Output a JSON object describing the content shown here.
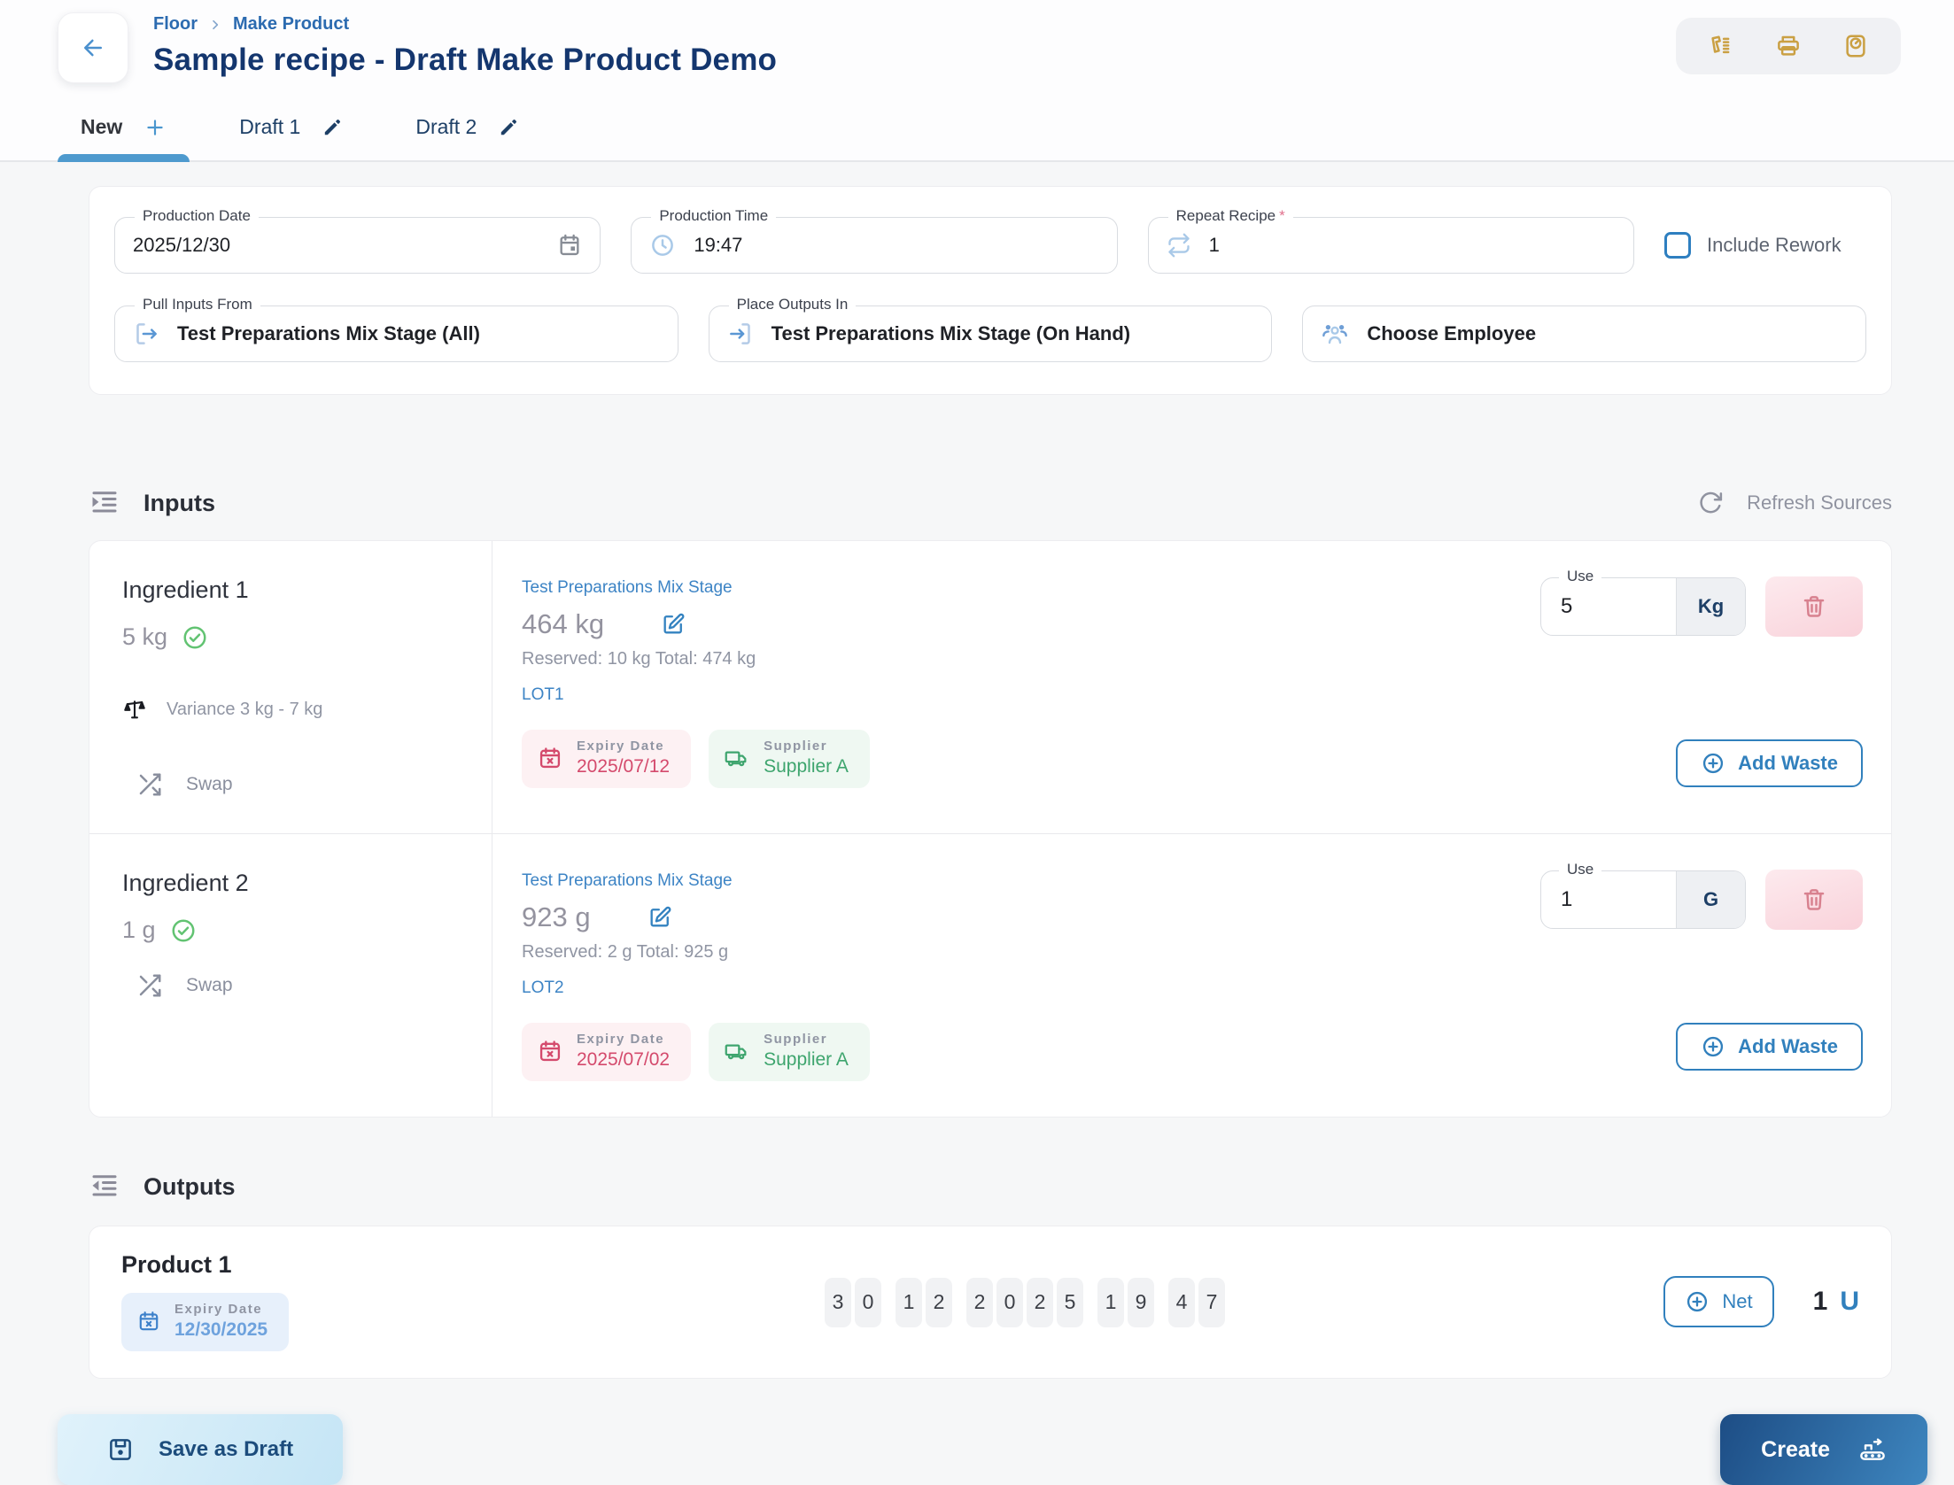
{
  "colors": {
    "accent_blue": "#3180bd",
    "navy_title": "#14366e",
    "amber_icons": "#caa043",
    "danger_red": "#d44a6c",
    "success_green": "#3ea56e",
    "tab_underline": "#4e9ace"
  },
  "header": {
    "breadcrumb": [
      "Floor",
      "Make Product"
    ],
    "title": "Sample recipe - Draft Make Product Demo"
  },
  "tabs": {
    "new_label": "New",
    "draft1_label": "Draft 1",
    "draft2_label": "Draft 2"
  },
  "form": {
    "production_date": {
      "label": "Production Date",
      "value": "2025/12/30"
    },
    "production_time": {
      "label": "Production Time",
      "value": "19:47"
    },
    "repeat_recipe": {
      "label": "Repeat Recipe",
      "required_mark": "*",
      "value": "1"
    },
    "include_rework_label": "Include Rework",
    "pull_inputs": {
      "label": "Pull Inputs From",
      "value": "Test Preparations Mix Stage (All)"
    },
    "place_outputs": {
      "label": "Place Outputs In",
      "value": "Test Preparations Mix Stage (On Hand)"
    },
    "choose_employee_label": "Choose Employee"
  },
  "inputs_section": {
    "title": "Inputs",
    "refresh_label": "Refresh Sources",
    "ingredients": [
      {
        "name": "Ingredient 1",
        "required_qty": "5 kg",
        "variance": "Variance 3 kg - 7 kg",
        "swap_label": "Swap",
        "source_link": "Test Preparations Mix Stage",
        "available_qty": "464 kg",
        "reserved_text": "Reserved: 10 kg Total: 474 kg",
        "lot": "LOT1",
        "expiry_label": "Expiry Date",
        "expiry_date": "2025/07/12",
        "supplier_label": "Supplier",
        "supplier_name": "Supplier A",
        "use_label": "Use",
        "use_value": "5",
        "use_unit": "Kg",
        "add_waste_label": "Add Waste"
      },
      {
        "name": "Ingredient 2",
        "required_qty": "1 g",
        "swap_label": "Swap",
        "source_link": "Test Preparations Mix Stage",
        "available_qty": "923 g",
        "reserved_text": "Reserved: 2 g Total: 925 g",
        "lot": "LOT2",
        "expiry_label": "Expiry Date",
        "expiry_date": "2025/07/02",
        "supplier_label": "Supplier",
        "supplier_name": "Supplier A",
        "use_label": "Use",
        "use_value": "1",
        "use_unit": "G",
        "add_waste_label": "Add Waste"
      }
    ]
  },
  "outputs_section": {
    "title": "Outputs",
    "product": {
      "name": "Product 1",
      "expiry_label": "Expiry Date",
      "expiry_date": "12/30/2025",
      "digits": [
        "3",
        "0",
        "1",
        "2",
        "2",
        "0",
        "2",
        "5",
        "1",
        "9",
        "4",
        "7"
      ],
      "net_label": "Net",
      "quantity": "1",
      "unit": "U"
    }
  },
  "footer": {
    "save_draft_label": "Save as Draft",
    "create_label": "Create"
  }
}
